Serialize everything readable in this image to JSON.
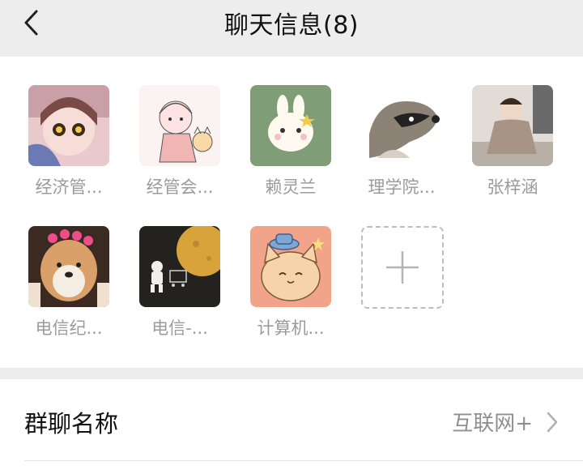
{
  "header": {
    "title": "聊天信息(8)",
    "back_icon": "chevron-left-icon"
  },
  "members": [
    {
      "name": "经济管...",
      "avatar": "anime-girl-avatar",
      "color": "#d8a7b6"
    },
    {
      "name": "经管会...",
      "avatar": "sketch-girl-cat-avatar",
      "color": "#f7e7e6"
    },
    {
      "name": "赖灵兰",
      "avatar": "bunny-avatar",
      "color": "#7f9e78"
    },
    {
      "name": "理学院...",
      "avatar": "raccoon-avatar",
      "color": "#5a5147"
    },
    {
      "name": "张梓涵",
      "avatar": "baby-photo-avatar",
      "color": "#c8bdb3"
    },
    {
      "name": "电信纪...",
      "avatar": "shiba-dog-avatar",
      "color": "#d8a06a"
    },
    {
      "name": "电信-...",
      "avatar": "astronaut-moon-avatar",
      "color": "#2a2724"
    },
    {
      "name": "计算机...",
      "avatar": "cat-hat-avatar",
      "color": "#f2a48a"
    }
  ],
  "add_member": {
    "icon": "plus-icon"
  },
  "group_name_row": {
    "label": "群聊名称",
    "value": "互联网+",
    "chevron_icon": "chevron-right-icon"
  }
}
